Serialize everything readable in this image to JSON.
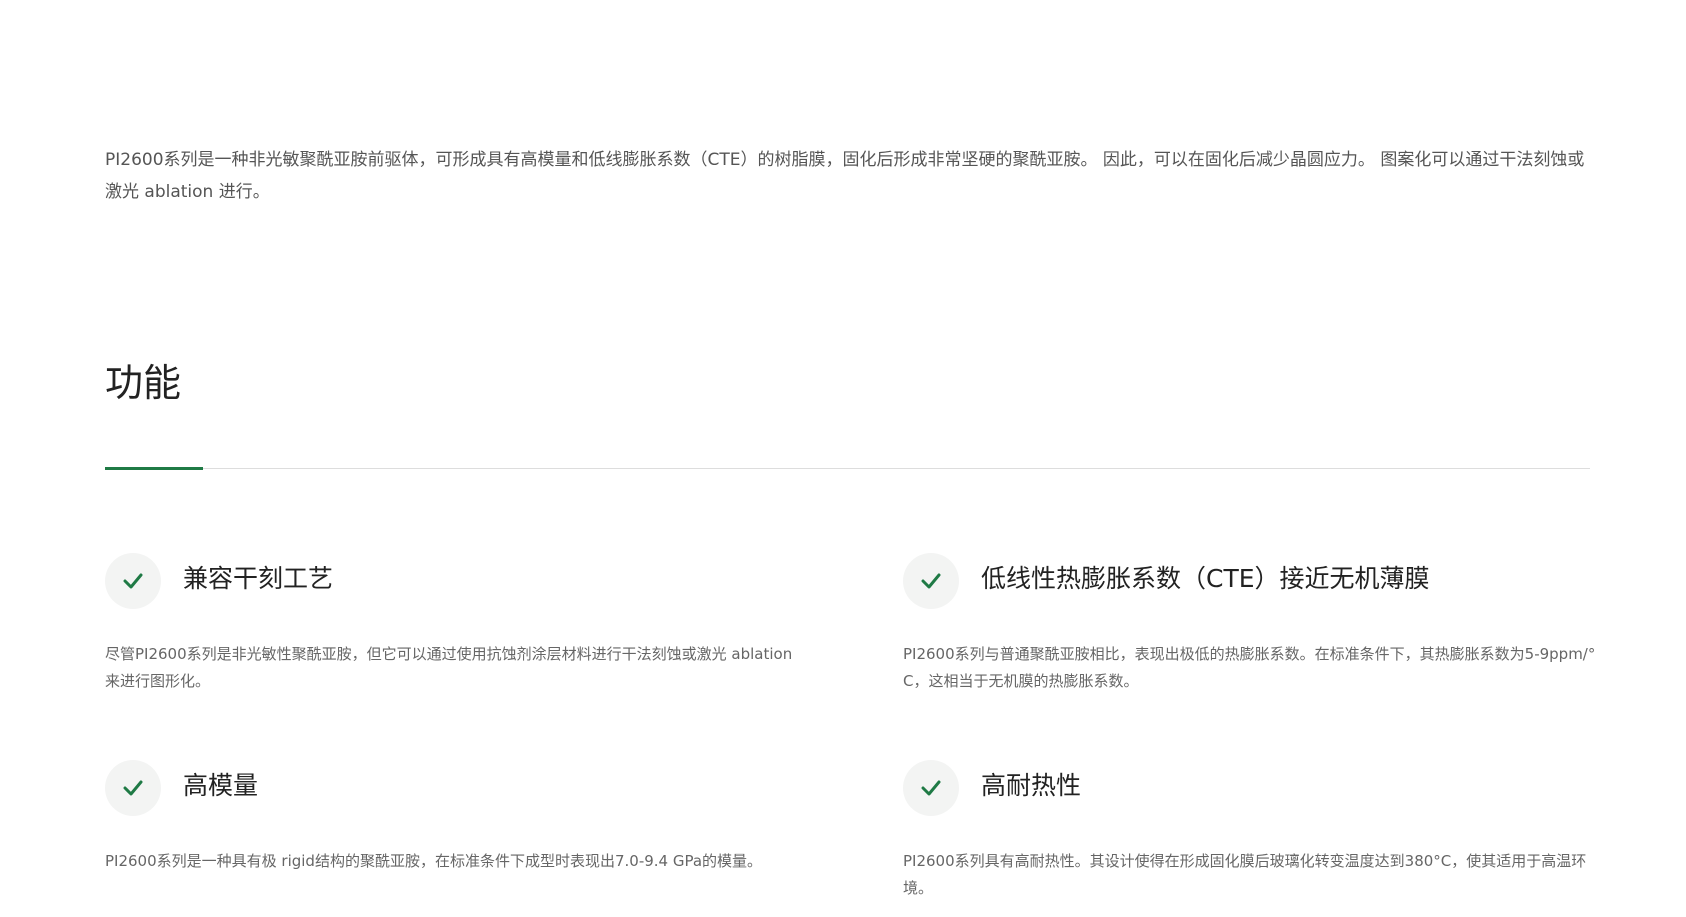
{
  "intro": {
    "text": "PI2600系列是一种非光敏聚酰亚胺前驱体，可形成具有高模量和低线膨胀系数（CTE）的树脂膜，固化后形成非常坚硬的聚酰亚胺。 因此，可以在固化后减少晶圆应力。 图案化可以通过干法刻蚀或激光 ablation 进行。"
  },
  "section": {
    "title": "功能"
  },
  "features": [
    {
      "icon": "check-icon",
      "title": "兼容干刻工艺",
      "description": "尽管PI2600系列是非光敏性聚酰亚胺，但它可以通过使用抗蚀剂涂层材料进行干法刻蚀或激光 ablation 来进行图形化。"
    },
    {
      "icon": "check-icon",
      "title": "低线性热膨胀系数（CTE）接近无机薄膜",
      "description": "PI2600系列与普通聚酰亚胺相比，表现出极低的热膨胀系数。在标准条件下，其热膨胀系数为5-9ppm/° C，这相当于无机膜的热膨胀系数。"
    },
    {
      "icon": "check-icon",
      "title": "高模量",
      "description": "PI2600系列是一种具有极 rigid结构的聚酰亚胺，在标准条件下成型时表现出7.0-9.4 GPa的模量。"
    },
    {
      "icon": "check-icon",
      "title": "高耐热性",
      "description": "PI2600系列具有高耐热性。其设计使得在形成固化膜后玻璃化转变温度达到380°C，使其适用于高温环境。"
    }
  ],
  "colors": {
    "accent": "#1f7a45",
    "check_background": "#f3f4f3",
    "divider": "#dddddd"
  }
}
